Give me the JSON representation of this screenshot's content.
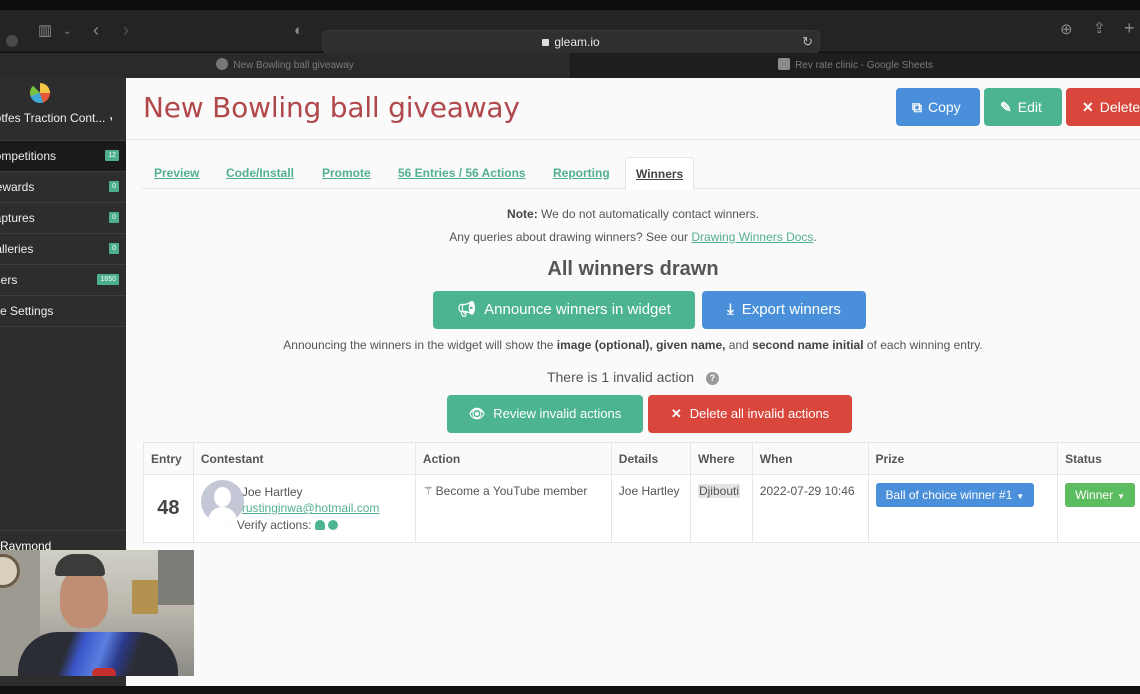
{
  "browser": {
    "url": "gleam.io",
    "tabs": [
      {
        "label": "New Bowling ball giveaway",
        "active": true
      },
      {
        "label": "Rev rate clinic - Google Sheets",
        "active": false
      }
    ]
  },
  "sidebar": {
    "account": "Hotfes Traction Cont...",
    "items": [
      {
        "label": "Competitions",
        "badge": "12",
        "active": true
      },
      {
        "label": "Rewards",
        "badge": "0",
        "active": false
      },
      {
        "label": "Captures",
        "badge": "0",
        "active": false
      },
      {
        "label": "Galleries",
        "badge": "0",
        "active": false
      },
      {
        "label": "Users",
        "badge": "1650",
        "active": false
      },
      {
        "label": "Site Settings",
        "badge": null,
        "active": false
      }
    ],
    "user_name": "Raymond"
  },
  "header": {
    "title": "New Bowling ball giveaway",
    "buttons": {
      "copy": "Copy",
      "edit": "Edit",
      "delete": "Delete"
    }
  },
  "nav_tabs": [
    {
      "label": "Preview",
      "active": false
    },
    {
      "label": "Code/Install",
      "active": false
    },
    {
      "label": "Promote",
      "active": false
    },
    {
      "label": "56 Entries / 56 Actions",
      "active": false
    },
    {
      "label": "Reporting",
      "active": false
    },
    {
      "label": "Winners",
      "active": true
    }
  ],
  "winners": {
    "note_label": "Note:",
    "note_text": " We do not automatically contact winners.",
    "queries_text": "Any queries about drawing winners? See our ",
    "docs_link": "Drawing Winners Docs",
    "queries_end": ".",
    "status_heading": "All winners drawn",
    "announce_button": "Announce winners in widget",
    "export_button": "Export winners",
    "announce_info": {
      "part1": "Announcing the winners in the widget will show the ",
      "bold1": "image (optional), given name,",
      "part2": " and ",
      "bold2": "second name initial",
      "part3": " of each winning entry."
    },
    "invalid_text": "There is 1 invalid action",
    "review_button": "Review invalid actions",
    "delete_invalid_button": "Delete all invalid actions"
  },
  "table": {
    "columns": [
      "Entry",
      "Contestant",
      "Action",
      "Details",
      "Where",
      "When",
      "Prize",
      "Status"
    ],
    "rows": [
      {
        "entry": "48",
        "name": "Joe Hartley",
        "email": "rustinginwa@hotmail.com",
        "verify_label": "Verify actions:",
        "action": "Become a YouTube member",
        "details": "Joe Hartley",
        "where": "Djibouti",
        "when": "2022-07-29 10:46",
        "prize": "Ball of choice winner #1",
        "status": "Winner"
      }
    ]
  },
  "colors": {
    "title": "#b0484c",
    "primary_blue": "#4a8fd9",
    "success_green": "#4cb393",
    "danger_red": "#d9473c",
    "status_green": "#5cbc60",
    "link_green": "#52b08f"
  }
}
